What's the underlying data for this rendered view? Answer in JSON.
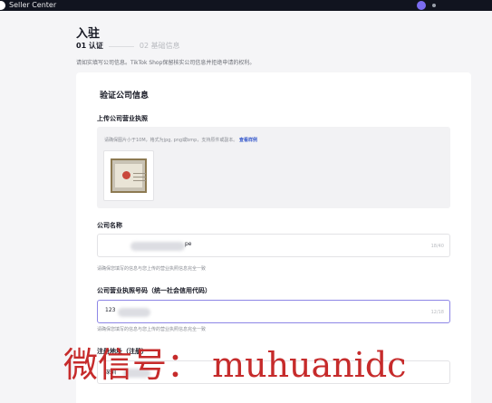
{
  "topbar": {
    "app_title": "Seller Center"
  },
  "page": {
    "title": "入驻",
    "steps": [
      {
        "label": "01 认证",
        "active": true
      },
      {
        "label": "02 基础信息",
        "active": false
      }
    ],
    "intro": "请如实填写公司信息。TikTok Shop保留核实公司信息并拒绝申请的权利。"
  },
  "form": {
    "section_title": "验证公司信息",
    "license_upload": {
      "label": "上传公司营业执照",
      "hint": "请确保图片小于10M，格式为jpg, png或bmp，支持原件或副本。",
      "sample_link": "查看样例"
    },
    "company_name": {
      "label": "公司名称",
      "value_suffix": "pe",
      "counter": "18/40",
      "helper": "请确保您填写的信息与您上传的营业执照信息完全一致"
    },
    "license_number": {
      "label": "公司营业执照号码（统一社会信用代码）",
      "value": "123",
      "counter": "12/18",
      "helper": "请确保您填写的信息与您上传的营业执照信息完全一致"
    },
    "registered_address": {
      "label": "注册地址（注册）",
      "value": "深圳"
    }
  },
  "watermark": {
    "text": "微信号： muhuanidc",
    "color": "#c62b2b"
  }
}
